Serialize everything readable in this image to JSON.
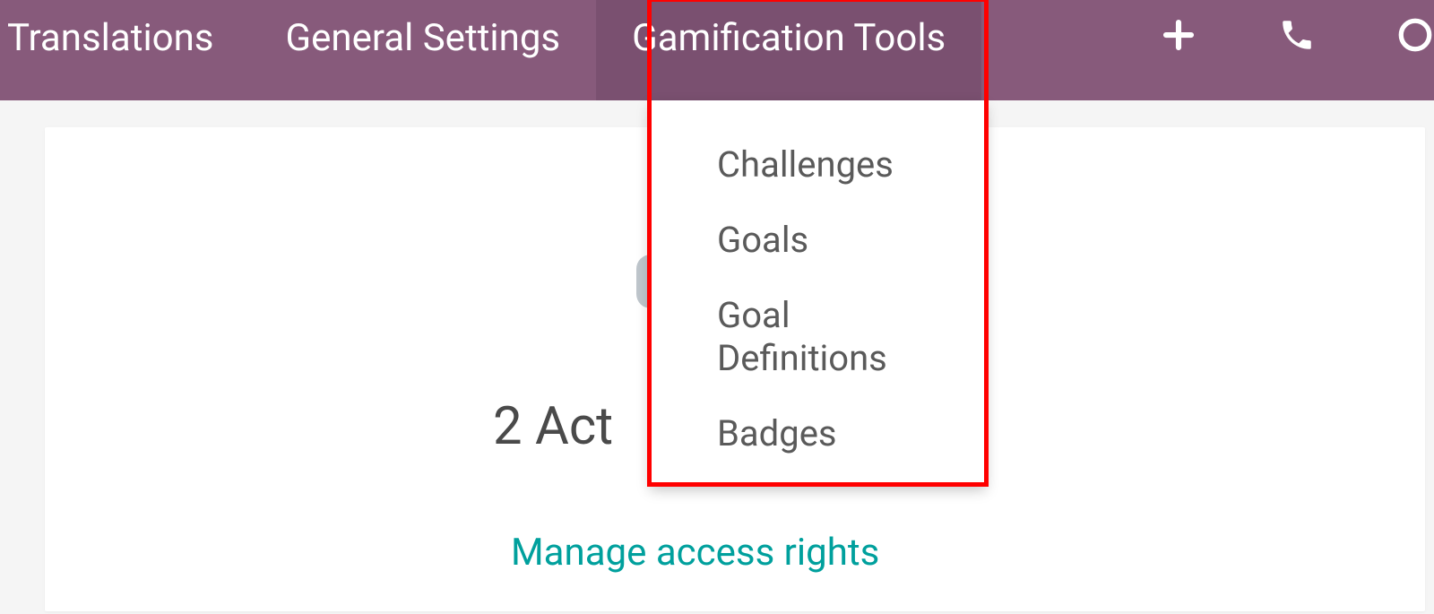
{
  "topbar": {
    "items": [
      {
        "label": "Translations"
      },
      {
        "label": "General Settings"
      },
      {
        "label": "Gamification Tools"
      }
    ]
  },
  "dropdown": {
    "items": [
      {
        "label": "Challenges"
      },
      {
        "label": "Goals"
      },
      {
        "label": "Goal Definitions"
      },
      {
        "label": "Badges"
      }
    ]
  },
  "content": {
    "partial_text": "2 Act",
    "link": "Manage access rights"
  }
}
